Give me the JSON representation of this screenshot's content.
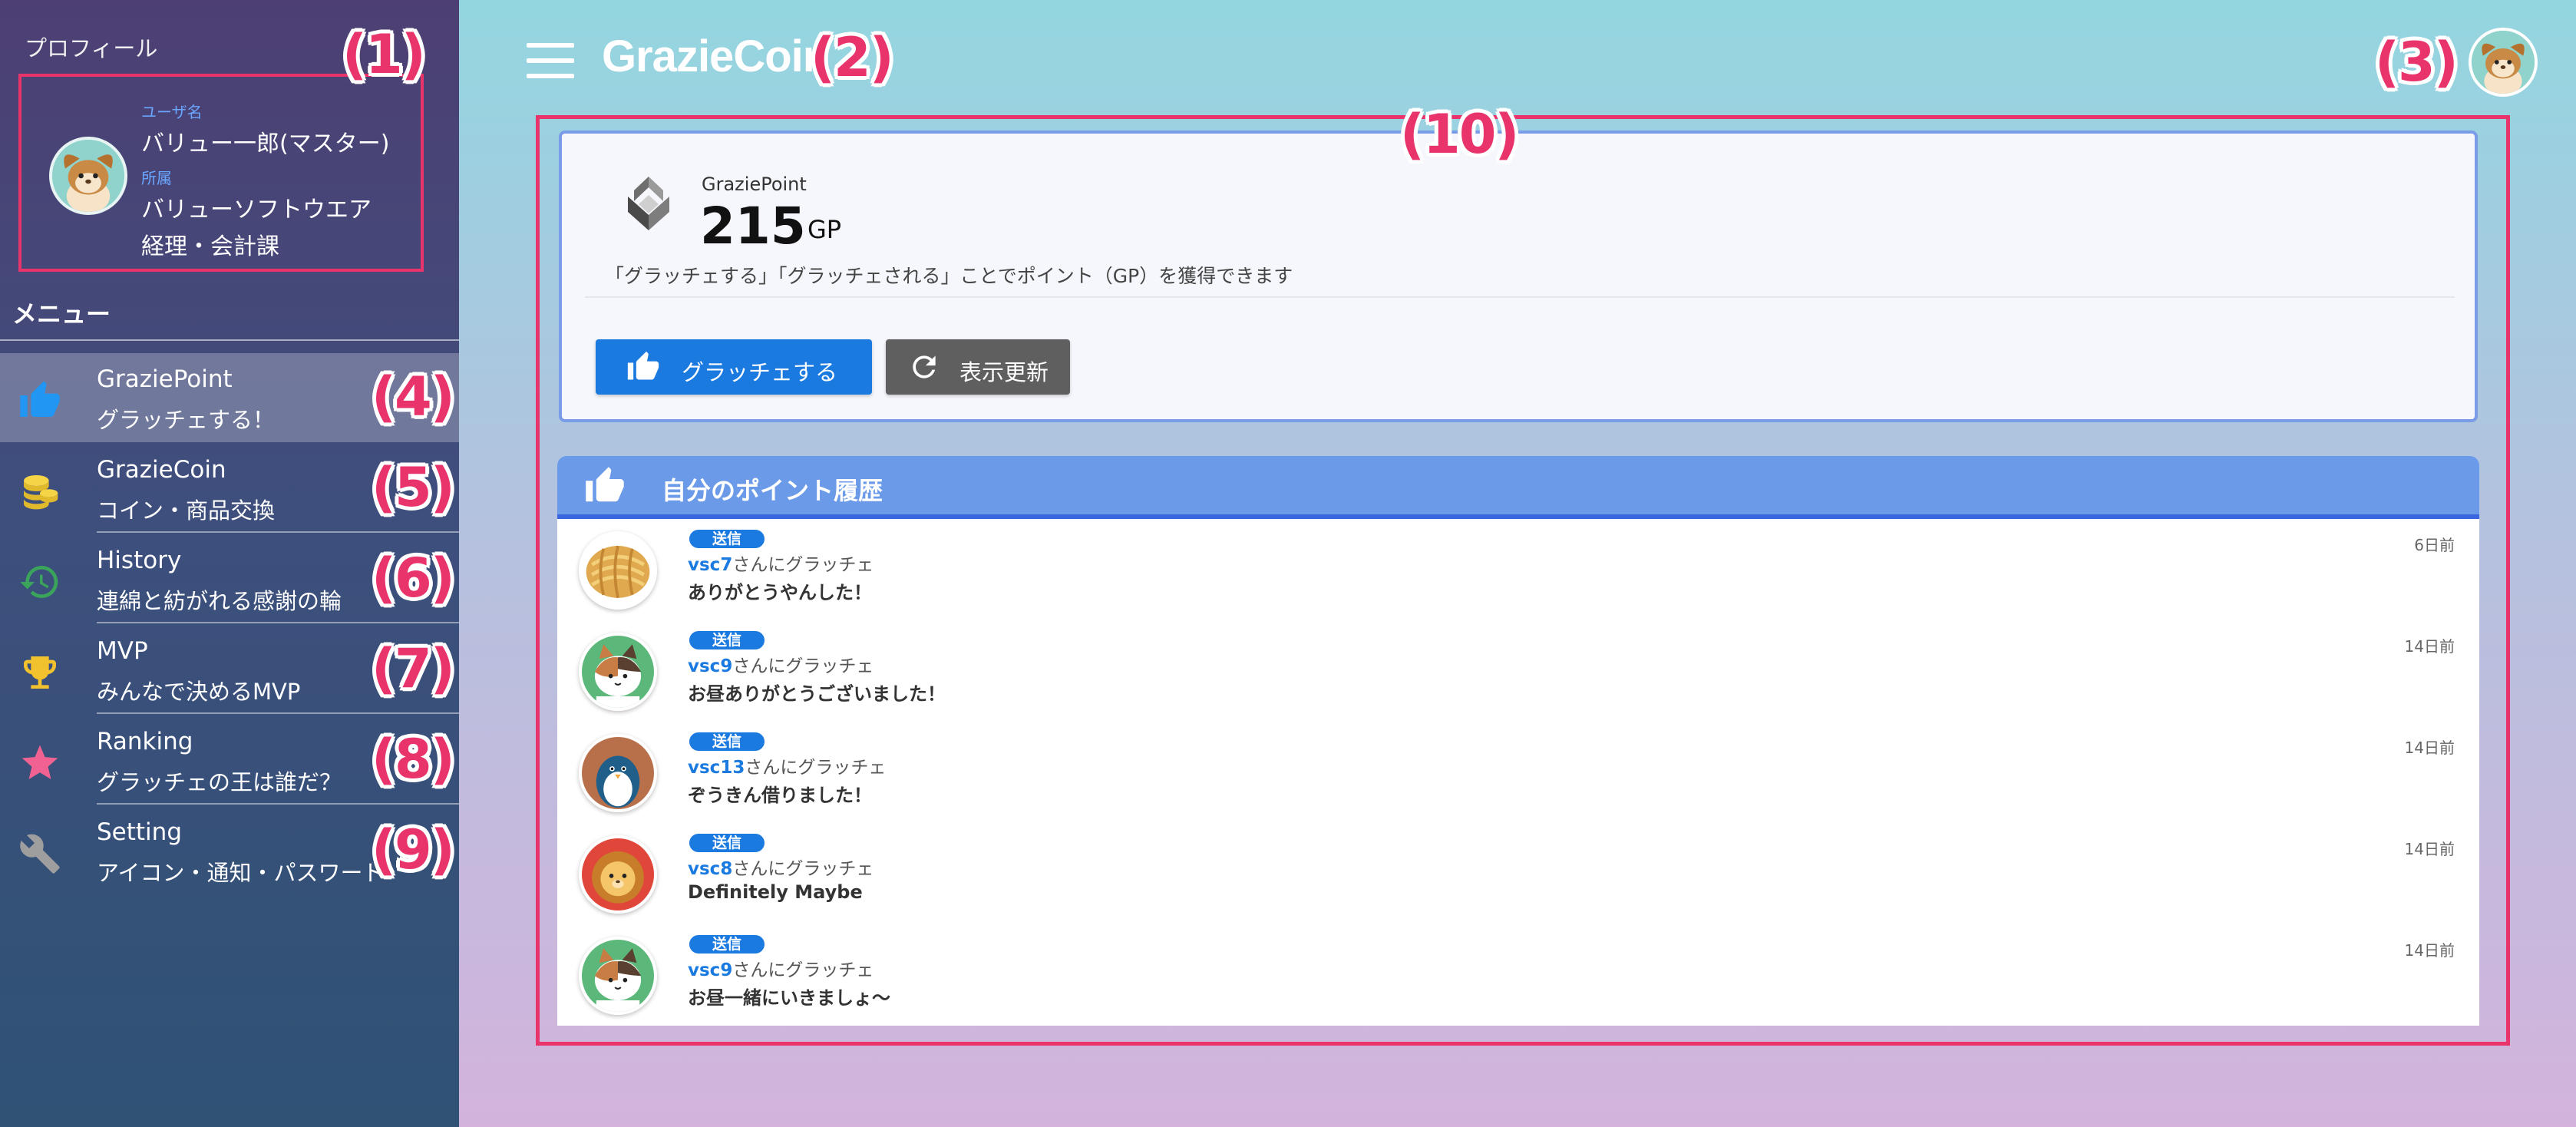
{
  "profile": {
    "heading": "プロフィール",
    "username_label": "ユーザ名",
    "username": "バリュー一郎(マスター)",
    "affiliation_label": "所属",
    "company": "バリューソフトウエア",
    "department": "経理・会計課"
  },
  "menu": {
    "heading": "メニュー",
    "items": [
      {
        "title": "GraziePoint",
        "subtitle": "グラッチェする！",
        "icon": "thumbs-up-icon",
        "active": true
      },
      {
        "title": "GrazieCoin",
        "subtitle": "コイン・商品交換",
        "icon": "coin-stack-icon",
        "active": false
      },
      {
        "title": "History",
        "subtitle": "連綿と紡がれる感謝の輪",
        "icon": "history-icon",
        "active": false
      },
      {
        "title": "MVP",
        "subtitle": "みんなで決めるMVP",
        "icon": "trophy-icon",
        "active": false
      },
      {
        "title": "Ranking",
        "subtitle": "グラッチェの王は誰だ？",
        "icon": "star-icon",
        "active": false
      },
      {
        "title": "Setting",
        "subtitle": "アイコン・通知・パスワード",
        "icon": "wrench-icon",
        "active": false
      }
    ]
  },
  "header": {
    "title": "GrazieCoin"
  },
  "annotations": [
    "(1)",
    "(2)",
    "(3)",
    "(4)",
    "(5)",
    "(6)",
    "(7)",
    "(8)",
    "(9)",
    "(10)"
  ],
  "point_card": {
    "label": "GraziePoint",
    "value": "215",
    "unit": "GP",
    "description": "「グラッチェする」「グラッチェされる」ことでポイント（GP）を獲得できます",
    "grazie_button": "グラッチェする",
    "refresh_button": "表示更新"
  },
  "history": {
    "title": "自分のポイント履歴",
    "rows": [
      {
        "badge": "送信",
        "user": "vsc7",
        "suffix": "さんにグラッチェ",
        "message": "ありがとうやんした！",
        "time": "6日前",
        "avatar": "bread-avatar"
      },
      {
        "badge": "送信",
        "user": "vsc9",
        "suffix": "さんにグラッチェ",
        "message": "お昼ありがとうございました！",
        "time": "14日前",
        "avatar": "calico-cat-avatar"
      },
      {
        "badge": "送信",
        "user": "vsc13",
        "suffix": "さんにグラッチェ",
        "message": "ぞうきん借りました！",
        "time": "14日前",
        "avatar": "penguin-avatar"
      },
      {
        "badge": "送信",
        "user": "vsc8",
        "suffix": "さんにグラッチェ",
        "message": "Definitely Maybe",
        "time": "14日前",
        "avatar": "lion-avatar"
      },
      {
        "badge": "送信",
        "user": "vsc9",
        "suffix": "さんにグラッチェ",
        "message": "お昼一緒にいきましょ〜",
        "time": "14日前",
        "avatar": "calico-cat-avatar"
      }
    ]
  },
  "colors": {
    "accent": "#1a7ae0",
    "annotation": "#e8336b",
    "history_header": "#6b9ae8",
    "sidebar": "#3e4f7d"
  }
}
